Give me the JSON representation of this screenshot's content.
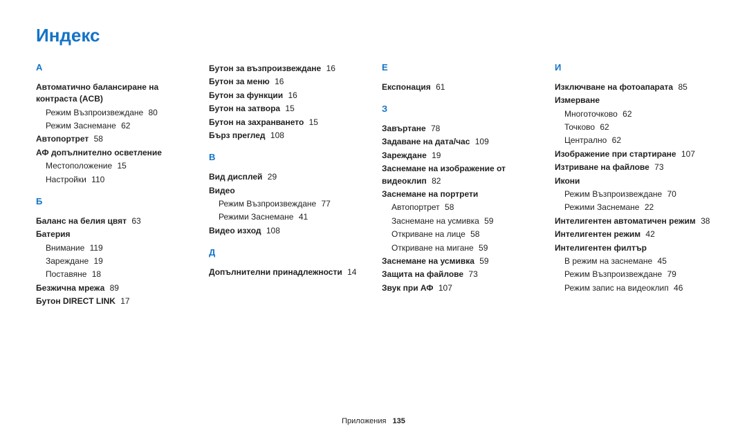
{
  "title": "Индекс",
  "footer": {
    "label": "Приложения",
    "page": "135"
  },
  "columns": [
    {
      "sections": [
        {
          "letter": "А",
          "entries": [
            {
              "head": "Автоматично балансиране на контраста (ACB)",
              "subs": [
                {
                  "text": "Режим Възпроизвеждане",
                  "page": "80"
                },
                {
                  "text": "Режим Заснемане",
                  "page": "62"
                }
              ]
            },
            {
              "head": "Автопортрет",
              "page": "58"
            },
            {
              "head": "АФ допълнително осветление",
              "subs": [
                {
                  "text": "Местоположение",
                  "page": "15"
                },
                {
                  "text": "Настройки",
                  "page": "110"
                }
              ]
            }
          ]
        },
        {
          "letter": "Б",
          "entries": [
            {
              "head": "Баланс на белия цвят",
              "page": "63"
            },
            {
              "head": "Батерия",
              "subs": [
                {
                  "text": "Внимание",
                  "page": "119"
                },
                {
                  "text": "Зареждане",
                  "page": "19"
                },
                {
                  "text": "Поставяне",
                  "page": "18"
                }
              ]
            },
            {
              "head": "Безжична мрежа",
              "page": "89"
            },
            {
              "head": "Бутон DIRECT LINK",
              "page": "17"
            }
          ]
        }
      ]
    },
    {
      "sections": [
        {
          "letter": "",
          "entries": [
            {
              "head": "Бутон за възпроизвеждане",
              "page": "16"
            },
            {
              "head": "Бутон за меню",
              "page": "16"
            },
            {
              "head": "Бутон за функции",
              "page": "16"
            },
            {
              "head": "Бутон на затвора",
              "page": "15"
            },
            {
              "head": "Бутон на захранването",
              "page": "15"
            },
            {
              "head": "Бърз преглед",
              "page": "108"
            }
          ]
        },
        {
          "letter": "В",
          "entries": [
            {
              "head": "Вид дисплей",
              "page": "29"
            },
            {
              "head": "Видео",
              "subs": [
                {
                  "text": "Режим Възпроизвеждане",
                  "page": "77"
                },
                {
                  "text": "Режими Заснемане",
                  "page": "41"
                }
              ]
            },
            {
              "head": "Видео изход",
              "page": "108"
            }
          ]
        },
        {
          "letter": "Д",
          "entries": [
            {
              "head": "Допълнителни принадлежности",
              "page": "14"
            }
          ]
        }
      ]
    },
    {
      "sections": [
        {
          "letter": "Е",
          "entries": [
            {
              "head": "Експонация",
              "page": "61"
            }
          ]
        },
        {
          "letter": "З",
          "entries": [
            {
              "head": "Завъртане",
              "page": "78"
            },
            {
              "head": "Задаване на дата/час",
              "page": "109"
            },
            {
              "head": "Зареждане",
              "page": "19"
            },
            {
              "head": "Заснемане на изображение от видеоклип",
              "page": "82"
            },
            {
              "head": "Заснемане на портрети",
              "subs": [
                {
                  "text": "Автопортрет",
                  "page": "58"
                },
                {
                  "text": "Заснемане на усмивка",
                  "page": "59"
                },
                {
                  "text": "Откриване на лице",
                  "page": "58"
                },
                {
                  "text": "Откриване на мигане",
                  "page": "59"
                }
              ]
            },
            {
              "head": "Заснемане на усмивка",
              "page": "59"
            },
            {
              "head": "Защита на файлове",
              "page": "73"
            },
            {
              "head": "Звук при АФ",
              "page": "107"
            }
          ]
        }
      ]
    },
    {
      "sections": [
        {
          "letter": "И",
          "entries": [
            {
              "head": "Изключване на фотоапарата",
              "page": "85"
            },
            {
              "head": "Измерване",
              "subs": [
                {
                  "text": "Многоточково",
                  "page": "62"
                },
                {
                  "text": "Точково",
                  "page": "62"
                },
                {
                  "text": "Централно",
                  "page": "62"
                }
              ]
            },
            {
              "head": "Изображение при стартиране",
              "page": "107"
            },
            {
              "head": "Изтриване на файлове",
              "page": "73"
            },
            {
              "head": "Икони",
              "subs": [
                {
                  "text": "Режим Възпроизвеждане",
                  "page": "70"
                },
                {
                  "text": "Режими Заснемане",
                  "page": "22"
                }
              ]
            },
            {
              "head": "Интелигентен автоматичен режим",
              "page": "38"
            },
            {
              "head": "Интелигентен режим",
              "page": "42"
            },
            {
              "head": "Интелигентен филтър",
              "subs": [
                {
                  "text": "В режим на заснемане",
                  "page": "45"
                },
                {
                  "text": "Режим Възпроизвеждане",
                  "page": "79"
                },
                {
                  "text": "Режим запис на видеоклип",
                  "page": "46"
                }
              ]
            }
          ]
        }
      ]
    }
  ]
}
